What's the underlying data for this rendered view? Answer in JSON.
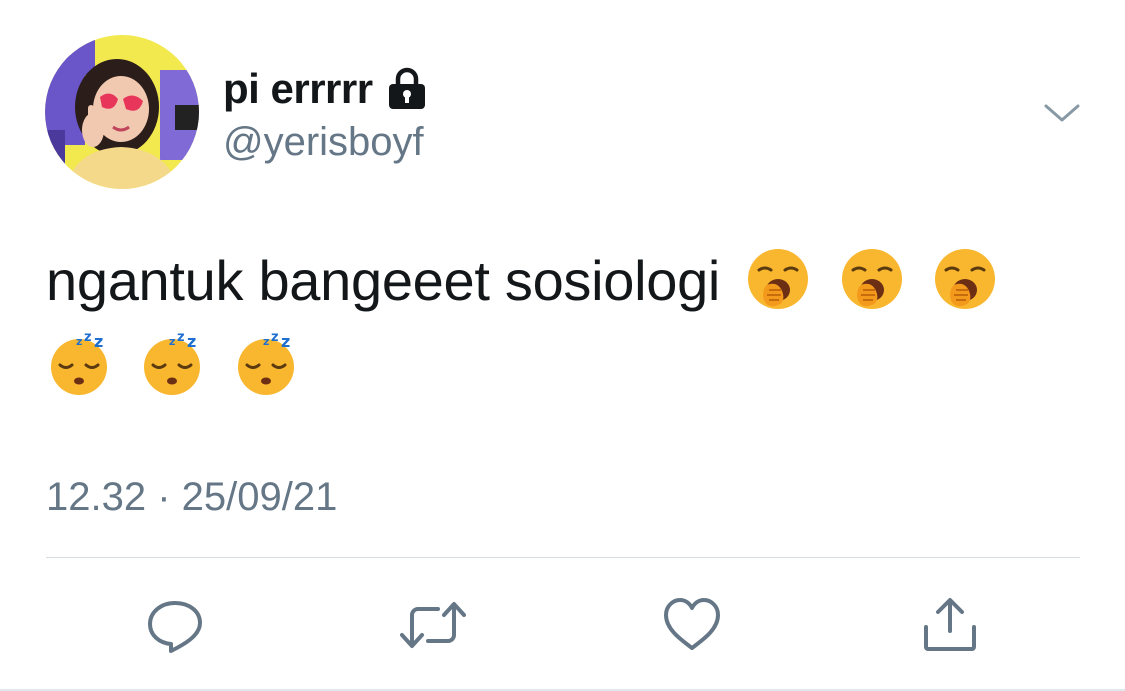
{
  "tweet": {
    "display_name": "pi errrrr",
    "handle": "@yerisboyf",
    "text": "ngantuk bangeeet sosiologi",
    "emojis": [
      "yawning-face",
      "yawning-face",
      "yawning-face",
      "sleeping-face",
      "sleeping-face",
      "sleeping-face"
    ],
    "timestamp": "12.32 · 25/09/21"
  },
  "icons": {
    "account_lock": "lock-icon",
    "menu": "chevron-down-icon",
    "actions": [
      "reply-icon",
      "retweet-icon",
      "like-icon",
      "share-icon"
    ]
  },
  "colors": {
    "text": "#14171a",
    "secondary": "#657786",
    "divider": "#d6dde3",
    "avatar_bg": "#f2e94e",
    "avatar_accent": "#6a55c9"
  }
}
